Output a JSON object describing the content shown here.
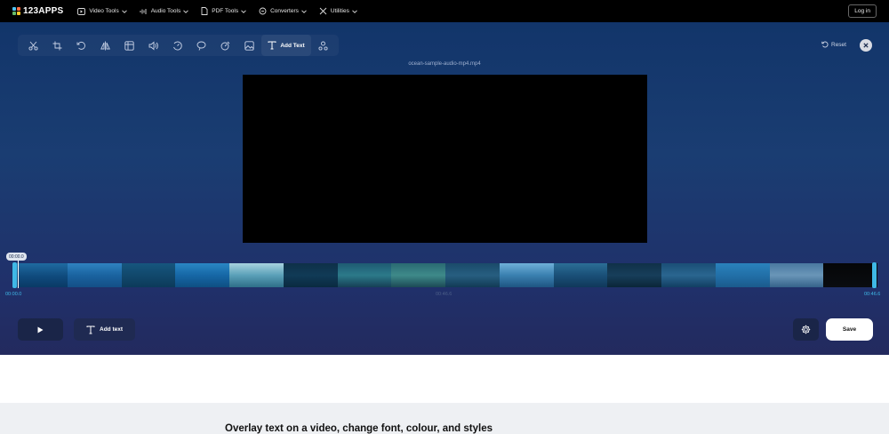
{
  "nav": {
    "logo": "123APPS",
    "items": [
      {
        "label": "Video Tools",
        "icon": "video-icon"
      },
      {
        "label": "Audio Tools",
        "icon": "audio-icon"
      },
      {
        "label": "PDF Tools",
        "icon": "pdf-icon"
      },
      {
        "label": "Converters",
        "icon": "converters-icon"
      },
      {
        "label": "Utilities",
        "icon": "utilities-icon"
      }
    ],
    "login": "Log in"
  },
  "toolbar": {
    "tools": [
      "cut-icon",
      "crop-icon",
      "rotate-icon",
      "flip-icon",
      "resize-icon",
      "volume-icon",
      "speed-icon",
      "loop-icon",
      "stabilize-icon",
      "image-icon",
      "add-text-icon",
      "record-icon"
    ],
    "active_label": "Add Text",
    "reset": "Reset"
  },
  "video": {
    "filename": "ocean-sample-audio-mp4.mp4"
  },
  "timeline": {
    "bubble": "00:00.0",
    "start": "00:00.0",
    "mid": "00:46.6",
    "end": "00:46.6"
  },
  "controls": {
    "add_text": "Add text",
    "save": "Save"
  },
  "content": {
    "headline": "Overlay text on a video, change font, colour, and styles"
  },
  "colors": {
    "accent": "#3fb8e6",
    "nav_bg": "#000000",
    "editor_top": "#12356a",
    "editor_bottom": "#232a5e"
  }
}
